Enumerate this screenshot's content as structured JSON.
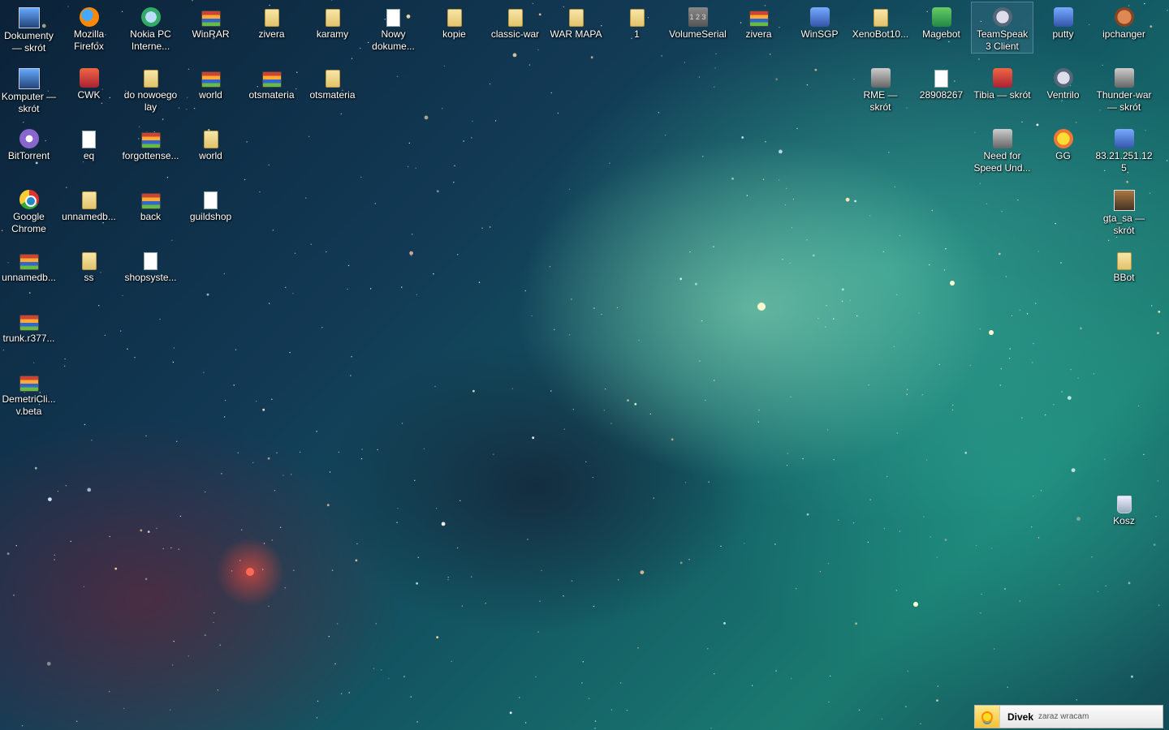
{
  "desktop": {
    "icons": [
      {
        "label": "Dokumenty — skrót",
        "icon": "documents-shortcut-icon",
        "kind": "pc"
      },
      {
        "label": "Mozilla Firefox",
        "icon": "firefox-icon",
        "kind": "firefox"
      },
      {
        "label": "Nokia PC Interne...",
        "icon": "nokia-pc-internet-icon",
        "kind": "nokia"
      },
      {
        "label": "WinRAR",
        "icon": "winrar-icon",
        "kind": "rar"
      },
      {
        "label": "zivera",
        "icon": "folder-icon",
        "kind": "folder"
      },
      {
        "label": "karamy",
        "icon": "folder-icon",
        "kind": "folder"
      },
      {
        "label": "Nowy dokume...",
        "icon": "document-icon",
        "kind": "doc"
      },
      {
        "label": "kopie",
        "icon": "folder-icon",
        "kind": "folder"
      },
      {
        "label": "classic-war",
        "icon": "folder-icon",
        "kind": "folder"
      },
      {
        "label": "WAR MAPA",
        "icon": "folder-icon",
        "kind": "folder"
      },
      {
        "label": "1",
        "icon": "folder-icon",
        "kind": "folder"
      },
      {
        "label": "VolumeSerial",
        "icon": "volumeserial-icon",
        "kind": "num"
      },
      {
        "label": "zivera",
        "icon": "winrar-archive-icon",
        "kind": "rar"
      },
      {
        "label": "WinSGP",
        "icon": "winsgp-icon",
        "kind": "blue"
      },
      {
        "label": "XenoBot10...",
        "icon": "folder-icon",
        "kind": "folder"
      },
      {
        "label": "Magebot",
        "icon": "magebot-icon",
        "kind": "green"
      },
      {
        "label": "TeamSpeak 3 Client",
        "icon": "teamspeak-icon",
        "kind": "ts"
      },
      {
        "label": "putty",
        "icon": "putty-icon",
        "kind": "blue"
      },
      {
        "label": "ipchanger",
        "icon": "ipchanger-icon",
        "kind": "squirrel"
      },
      {
        "label": "Komputer — skrót",
        "icon": "computer-icon",
        "kind": "pc"
      },
      {
        "label": "CWK",
        "icon": "cwk-icon",
        "kind": "red"
      },
      {
        "label": "do nowoego lay",
        "icon": "folder-icon",
        "kind": "folder"
      },
      {
        "label": "world",
        "icon": "winrar-archive-icon",
        "kind": "rar"
      },
      {
        "label": "otsmateria",
        "icon": "winrar-archive-icon",
        "kind": "rar"
      },
      {
        "label": "otsmateria",
        "icon": "folder-icon",
        "kind": "folder"
      },
      {
        "label": "RME — skrót",
        "icon": "rme-icon",
        "kind": "gray"
      },
      {
        "label": "28908267",
        "icon": "document-icon",
        "kind": "doc"
      },
      {
        "label": "Tibia — skrót",
        "icon": "tibia-icon",
        "kind": "red"
      },
      {
        "label": "Ventrilo",
        "icon": "ventrilo-icon",
        "kind": "ts"
      },
      {
        "label": "Thunder-war — skrót",
        "icon": "thunder-war-icon",
        "kind": "gray"
      },
      {
        "label": "BitTorrent",
        "icon": "bittorrent-icon",
        "kind": "bt"
      },
      {
        "label": "eq",
        "icon": "document-icon",
        "kind": "doc"
      },
      {
        "label": "forgottense...",
        "icon": "winrar-archive-icon",
        "kind": "rar"
      },
      {
        "label": "world",
        "icon": "folder-icon",
        "kind": "folder"
      },
      {
        "label": "Need for Speed Und...",
        "icon": "nfs-icon",
        "kind": "gray"
      },
      {
        "label": "GG",
        "icon": "gadu-gadu-icon",
        "kind": "gg"
      },
      {
        "label": "83.21.251.125",
        "icon": "network-icon",
        "kind": "blue"
      },
      {
        "label": "Google Chrome",
        "icon": "chrome-icon",
        "kind": "chrome"
      },
      {
        "label": "unnamedb...",
        "icon": "folder-icon",
        "kind": "folder"
      },
      {
        "label": "back",
        "icon": "winrar-archive-icon",
        "kind": "rar"
      },
      {
        "label": "guildshop",
        "icon": "document-icon",
        "kind": "doc"
      },
      {
        "label": "gta_sa — skrót",
        "icon": "gta-icon",
        "kind": "gta"
      },
      {
        "label": "unnamedb...",
        "icon": "winrar-archive-icon",
        "kind": "rar"
      },
      {
        "label": "ss",
        "icon": "folder-icon",
        "kind": "folder"
      },
      {
        "label": "shopsyste...",
        "icon": "document-icon",
        "kind": "doc"
      },
      {
        "label": "BBot",
        "icon": "folder-icon",
        "kind": "folder"
      },
      {
        "label": "trunk.r377...",
        "icon": "winrar-archive-icon",
        "kind": "rar"
      },
      {
        "label": "DemetriCli... v.beta",
        "icon": "winrar-archive-icon",
        "kind": "rar"
      },
      {
        "label": "Kosz",
        "icon": "recycle-bin-icon",
        "kind": "bin"
      }
    ],
    "num_glyph": "1 2 3"
  },
  "notification": {
    "name": "Divek",
    "status": "zaraz wracam",
    "icon": "gadu-gadu-sun-icon"
  }
}
